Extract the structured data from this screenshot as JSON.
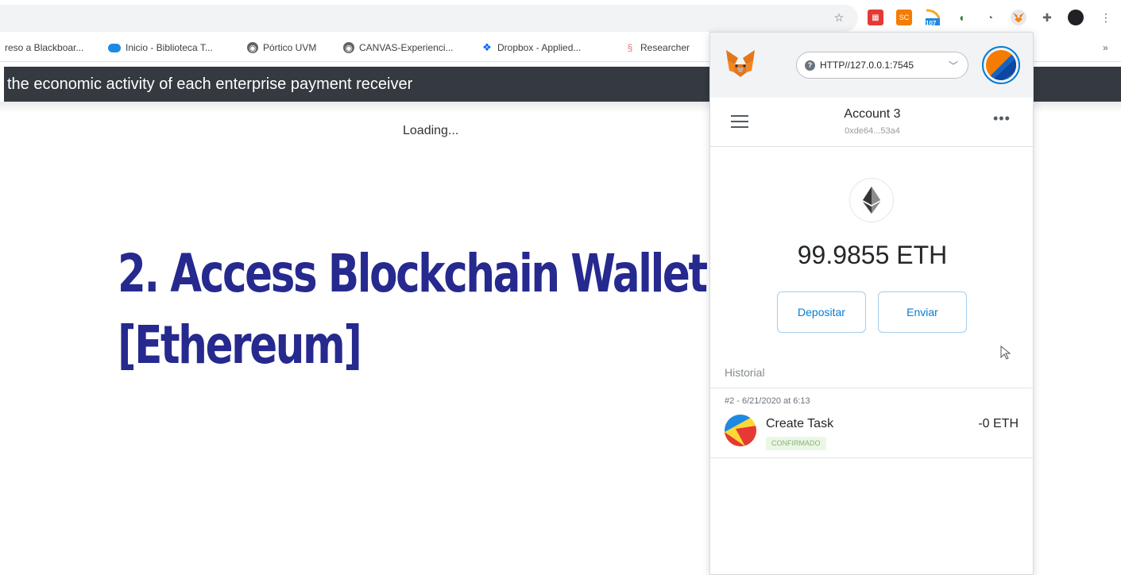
{
  "bookmarks": [
    {
      "label": "reso a Blackboar...",
      "icon": "bookmark-icon"
    },
    {
      "label": "Inicio - Biblioteca T...",
      "icon": "cloud-icon"
    },
    {
      "label": "Pórtico UVM",
      "icon": "globe-icon"
    },
    {
      "label": "CANVAS-Experienci...",
      "icon": "globe-icon"
    },
    {
      "label": "Dropbox - Applied...",
      "icon": "dropbox-icon"
    },
    {
      "label": "Researcher",
      "icon": "researcher-icon"
    }
  ],
  "toolbar": {
    "extension_badge": "107",
    "extension_label_sc": "SC"
  },
  "page": {
    "header_text": "the economic activity of each enterprise payment receiver",
    "loading_text": "Loading...",
    "title_line1": "2. Access Blockchain Wallet",
    "title_line2": "[Ethereum]",
    "title_color": "#26298e"
  },
  "metamask": {
    "network": "HTTP//127.0.0.1:7545",
    "account_name": "Account 3",
    "account_address": "0xde64...53a4",
    "balance": "99.9855 ETH",
    "deposit_label": "Depositar",
    "send_label": "Enviar",
    "history_label": "Historial",
    "transactions": [
      {
        "date": "#2 - 6/21/2020 at 6:13",
        "title": "Create Task",
        "status": "CONFIRMADO",
        "amount": "-0 ETH"
      }
    ],
    "accent_color": "#037dd6"
  }
}
